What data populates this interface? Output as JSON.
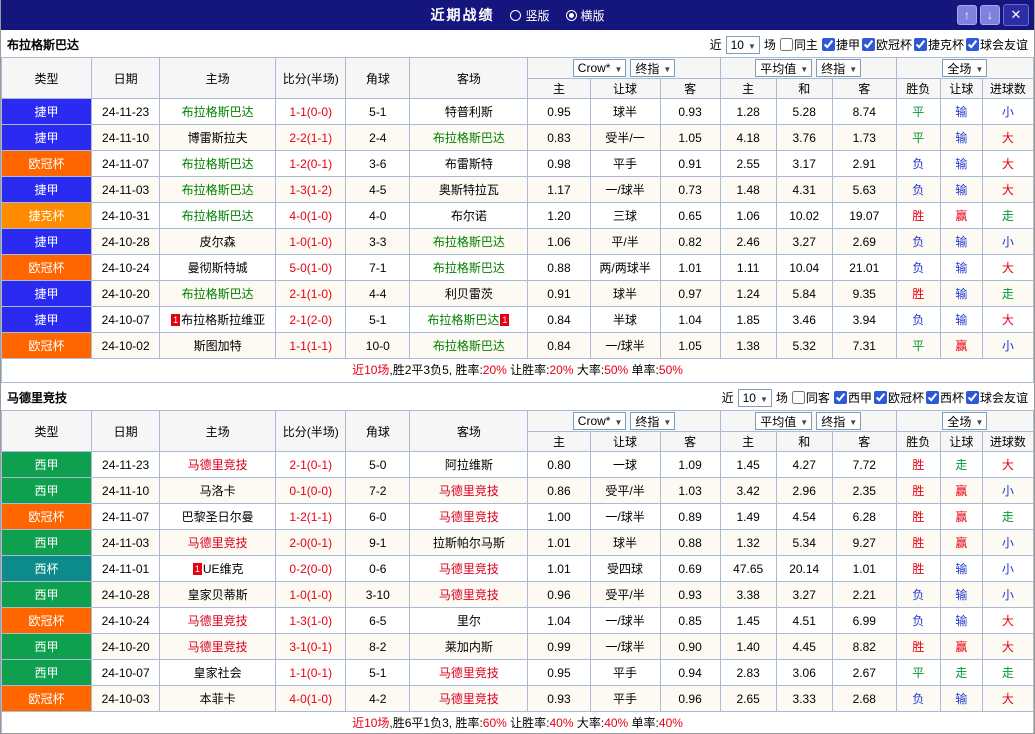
{
  "titlebar": {
    "title": "近期战绩",
    "vertical": "竖版",
    "horizontal": "横版",
    "up_icon": "↑",
    "down_icon": "↓",
    "close_icon": "✕"
  },
  "palette": {
    "win_red": "#e60012",
    "draw_green": "#009933",
    "lose_blue": "#2337cf",
    "team_green": "#008000",
    "team_red": "#d9001b"
  },
  "sections": [
    {
      "team": "布拉格斯巴达",
      "filter": {
        "near": "近",
        "count": "10",
        "games": "场",
        "same": {
          "label": "同主",
          "checked": false
        },
        "leagues": [
          {
            "label": "捷甲",
            "checked": true
          },
          {
            "label": "欧冠杯",
            "checked": true
          },
          {
            "label": "捷克杯",
            "checked": true
          },
          {
            "label": "球会友谊",
            "checked": true
          }
        ]
      },
      "header": {
        "type": "类型",
        "date": "日期",
        "home": "主场",
        "score": "比分(半场)",
        "corner": "角球",
        "away": "客场",
        "book_select": "Crow*",
        "book_index_select": "终指",
        "avg_select": "平均值",
        "avg_index_select": "终指",
        "full_select": "全场",
        "sub": [
          "主",
          "让球",
          "客",
          "主",
          "和",
          "客",
          "胜负",
          "让球",
          "进球数"
        ]
      },
      "rows": [
        {
          "league": "捷甲",
          "league_color": "#2a2af0",
          "date": "24-11-23",
          "home": "布拉格斯巴达",
          "home_color": "green",
          "home_badge": "",
          "score": "1-1(0-0)",
          "corner": "5-1",
          "away": "特普利斯",
          "away_color": "",
          "away_badge": "",
          "o1": "0.95",
          "h": "球半",
          "o2": "0.93",
          "a1": "1.28",
          "a2": "5.28",
          "a3": "8.74",
          "r1": "平",
          "r1c": "green",
          "r2": "输",
          "r2c": "blue",
          "r3": "小",
          "r3c": "blue"
        },
        {
          "league": "捷甲",
          "league_color": "#2a2af0",
          "date": "24-11-10",
          "home": "博雷斯拉夫",
          "home_color": "",
          "home_badge": "",
          "score": "2-2(1-1)",
          "corner": "2-4",
          "away": "布拉格斯巴达",
          "away_color": "green",
          "away_badge": "",
          "o1": "0.83",
          "h": "受半/一",
          "o2": "1.05",
          "a1": "4.18",
          "a2": "3.76",
          "a3": "1.73",
          "r1": "平",
          "r1c": "green",
          "r2": "输",
          "r2c": "blue",
          "r3": "大",
          "r3c": "red"
        },
        {
          "league": "欧冠杯",
          "league_color": "#ff6600",
          "date": "24-11-07",
          "home": "布拉格斯巴达",
          "home_color": "green",
          "home_badge": "",
          "score": "1-2(0-1)",
          "corner": "3-6",
          "away": "布雷斯特",
          "away_color": "",
          "away_badge": "",
          "o1": "0.98",
          "h": "平手",
          "o2": "0.91",
          "a1": "2.55",
          "a2": "3.17",
          "a3": "2.91",
          "r1": "负",
          "r1c": "blue",
          "r2": "输",
          "r2c": "blue",
          "r3": "大",
          "r3c": "red"
        },
        {
          "league": "捷甲",
          "league_color": "#2a2af0",
          "date": "24-11-03",
          "home": "布拉格斯巴达",
          "home_color": "green",
          "home_badge": "",
          "score": "1-3(1-2)",
          "corner": "4-5",
          "away": "奥斯特拉瓦",
          "away_color": "",
          "away_badge": "",
          "o1": "1.17",
          "h": "一/球半",
          "o2": "0.73",
          "a1": "1.48",
          "a2": "4.31",
          "a3": "5.63",
          "r1": "负",
          "r1c": "blue",
          "r2": "输",
          "r2c": "blue",
          "r3": "大",
          "r3c": "red"
        },
        {
          "league": "捷克杯",
          "league_color": "#ff8c00",
          "date": "24-10-31",
          "home": "布拉格斯巴达",
          "home_color": "green",
          "home_badge": "",
          "score": "4-0(1-0)",
          "corner": "4-0",
          "away": "布尔诺",
          "away_color": "",
          "away_badge": "",
          "o1": "1.20",
          "h": "三球",
          "o2": "0.65",
          "a1": "1.06",
          "a2": "10.02",
          "a3": "19.07",
          "r1": "胜",
          "r1c": "red",
          "r2": "赢",
          "r2c": "red",
          "r3": "走",
          "r3c": "green"
        },
        {
          "league": "捷甲",
          "league_color": "#2a2af0",
          "date": "24-10-28",
          "home": "皮尔森",
          "home_color": "",
          "home_badge": "",
          "score": "1-0(1-0)",
          "corner": "3-3",
          "away": "布拉格斯巴达",
          "away_color": "green",
          "away_badge": "",
          "o1": "1.06",
          "h": "平/半",
          "o2": "0.82",
          "a1": "2.46",
          "a2": "3.27",
          "a3": "2.69",
          "r1": "负",
          "r1c": "blue",
          "r2": "输",
          "r2c": "blue",
          "r3": "小",
          "r3c": "blue"
        },
        {
          "league": "欧冠杯",
          "league_color": "#ff6600",
          "date": "24-10-24",
          "home": "曼彻斯特城",
          "home_color": "",
          "home_badge": "",
          "score": "5-0(1-0)",
          "corner": "7-1",
          "away": "布拉格斯巴达",
          "away_color": "green",
          "away_badge": "",
          "o1": "0.88",
          "h": "两/两球半",
          "o2": "1.01",
          "a1": "1.11",
          "a2": "10.04",
          "a3": "21.01",
          "r1": "负",
          "r1c": "blue",
          "r2": "输",
          "r2c": "blue",
          "r3": "大",
          "r3c": "red"
        },
        {
          "league": "捷甲",
          "league_color": "#2a2af0",
          "date": "24-10-20",
          "home": "布拉格斯巴达",
          "home_color": "green",
          "home_badge": "",
          "score": "2-1(1-0)",
          "corner": "4-4",
          "away": "利贝雷茨",
          "away_color": "",
          "away_badge": "",
          "o1": "0.91",
          "h": "球半",
          "o2": "0.97",
          "a1": "1.24",
          "a2": "5.84",
          "a3": "9.35",
          "r1": "胜",
          "r1c": "red",
          "r2": "输",
          "r2c": "blue",
          "r3": "走",
          "r3c": "green"
        },
        {
          "league": "捷甲",
          "league_color": "#2a2af0",
          "date": "24-10-07",
          "home": "布拉格斯拉维亚",
          "home_color": "",
          "home_badge": "1",
          "score": "2-1(2-0)",
          "corner": "5-1",
          "away": "布拉格斯巴达",
          "away_color": "green",
          "away_badge": "1",
          "o1": "0.84",
          "h": "半球",
          "o2": "1.04",
          "a1": "1.85",
          "a2": "3.46",
          "a3": "3.94",
          "r1": "负",
          "r1c": "blue",
          "r2": "输",
          "r2c": "blue",
          "r3": "大",
          "r3c": "red"
        },
        {
          "league": "欧冠杯",
          "league_color": "#ff6600",
          "date": "24-10-02",
          "home": "斯图加特",
          "home_color": "",
          "home_badge": "",
          "score": "1-1(1-1)",
          "corner": "10-0",
          "away": "布拉格斯巴达",
          "away_color": "green",
          "away_badge": "",
          "o1": "0.84",
          "h": "一/球半",
          "o2": "1.05",
          "a1": "1.38",
          "a2": "5.32",
          "a3": "7.31",
          "r1": "平",
          "r1c": "green",
          "r2": "赢",
          "r2c": "red",
          "r3": "小",
          "r3c": "blue"
        }
      ],
      "summary": [
        {
          "t": "近10场",
          "c": "red"
        },
        {
          "t": ",胜2平3负5, 胜率:",
          "c": "black"
        },
        {
          "t": "20%",
          "c": "red"
        },
        {
          "t": " 让胜率:",
          "c": "black"
        },
        {
          "t": "20%",
          "c": "red"
        },
        {
          "t": " 大率:",
          "c": "black"
        },
        {
          "t": "50%",
          "c": "red"
        },
        {
          "t": " 单率:",
          "c": "black"
        },
        {
          "t": "50%",
          "c": "red"
        }
      ]
    },
    {
      "team": "马德里竞技",
      "filter": {
        "near": "近",
        "count": "10",
        "games": "场",
        "same": {
          "label": "同客",
          "checked": false
        },
        "leagues": [
          {
            "label": "西甲",
            "checked": true
          },
          {
            "label": "欧冠杯",
            "checked": true
          },
          {
            "label": "西杯",
            "checked": true
          },
          {
            "label": "球会友谊",
            "checked": true
          }
        ]
      },
      "header": {
        "type": "类型",
        "date": "日期",
        "home": "主场",
        "score": "比分(半场)",
        "corner": "角球",
        "away": "客场",
        "book_select": "Crow*",
        "book_index_select": "终指",
        "avg_select": "平均值",
        "avg_index_select": "终指",
        "full_select": "全场",
        "sub": [
          "主",
          "让球",
          "客",
          "主",
          "和",
          "客",
          "胜负",
          "让球",
          "进球数"
        ]
      },
      "rows": [
        {
          "league": "西甲",
          "league_color": "#0ea04e",
          "date": "24-11-23",
          "home": "马德里竞技",
          "home_color": "red",
          "home_badge": "",
          "score": "2-1(0-1)",
          "corner": "5-0",
          "away": "阿拉维斯",
          "away_color": "",
          "away_badge": "",
          "o1": "0.80",
          "h": "一球",
          "o2": "1.09",
          "a1": "1.45",
          "a2": "4.27",
          "a3": "7.72",
          "r1": "胜",
          "r1c": "red",
          "r2": "走",
          "r2c": "green",
          "r3": "大",
          "r3c": "red"
        },
        {
          "league": "西甲",
          "league_color": "#0ea04e",
          "date": "24-11-10",
          "home": "马洛卡",
          "home_color": "",
          "home_badge": "",
          "score": "0-1(0-0)",
          "corner": "7-2",
          "away": "马德里竞技",
          "away_color": "red",
          "away_badge": "",
          "o1": "0.86",
          "h": "受平/半",
          "o2": "1.03",
          "a1": "3.42",
          "a2": "2.96",
          "a3": "2.35",
          "r1": "胜",
          "r1c": "red",
          "r2": "赢",
          "r2c": "red",
          "r3": "小",
          "r3c": "blue"
        },
        {
          "league": "欧冠杯",
          "league_color": "#ff6600",
          "date": "24-11-07",
          "home": "巴黎圣日尔曼",
          "home_color": "",
          "home_badge": "",
          "score": "1-2(1-1)",
          "corner": "6-0",
          "away": "马德里竞技",
          "away_color": "red",
          "away_badge": "",
          "o1": "1.00",
          "h": "一/球半",
          "o2": "0.89",
          "a1": "1.49",
          "a2": "4.54",
          "a3": "6.28",
          "r1": "胜",
          "r1c": "red",
          "r2": "赢",
          "r2c": "red",
          "r3": "走",
          "r3c": "green"
        },
        {
          "league": "西甲",
          "league_color": "#0ea04e",
          "date": "24-11-03",
          "home": "马德里竞技",
          "home_color": "red",
          "home_badge": "",
          "score": "2-0(0-1)",
          "corner": "9-1",
          "away": "拉斯帕尔马斯",
          "away_color": "",
          "away_badge": "",
          "o1": "1.01",
          "h": "球半",
          "o2": "0.88",
          "a1": "1.32",
          "a2": "5.34",
          "a3": "9.27",
          "r1": "胜",
          "r1c": "red",
          "r2": "赢",
          "r2c": "red",
          "r3": "小",
          "r3c": "blue"
        },
        {
          "league": "西杯",
          "league_color": "#0d8b8b",
          "date": "24-11-01",
          "home": "UE维克",
          "home_color": "",
          "home_badge": "1",
          "score": "0-2(0-0)",
          "corner": "0-6",
          "away": "马德里竞技",
          "away_color": "red",
          "away_badge": "",
          "o1": "1.01",
          "h": "受四球",
          "o2": "0.69",
          "a1": "47.65",
          "a2": "20.14",
          "a3": "1.01",
          "r1": "胜",
          "r1c": "red",
          "r2": "输",
          "r2c": "blue",
          "r3": "小",
          "r3c": "blue"
        },
        {
          "league": "西甲",
          "league_color": "#0ea04e",
          "date": "24-10-28",
          "home": "皇家贝蒂斯",
          "home_color": "",
          "home_badge": "",
          "score": "1-0(1-0)",
          "corner": "3-10",
          "away": "马德里竞技",
          "away_color": "red",
          "away_badge": "",
          "o1": "0.96",
          "h": "受平/半",
          "o2": "0.93",
          "a1": "3.38",
          "a2": "3.27",
          "a3": "2.21",
          "r1": "负",
          "r1c": "blue",
          "r2": "输",
          "r2c": "blue",
          "r3": "小",
          "r3c": "blue"
        },
        {
          "league": "欧冠杯",
          "league_color": "#ff6600",
          "date": "24-10-24",
          "home": "马德里竞技",
          "home_color": "red",
          "home_badge": "",
          "score": "1-3(1-0)",
          "corner": "6-5",
          "away": "里尔",
          "away_color": "",
          "away_badge": "",
          "o1": "1.04",
          "h": "一/球半",
          "o2": "0.85",
          "a1": "1.45",
          "a2": "4.51",
          "a3": "6.99",
          "r1": "负",
          "r1c": "blue",
          "r2": "输",
          "r2c": "blue",
          "r3": "大",
          "r3c": "red"
        },
        {
          "league": "西甲",
          "league_color": "#0ea04e",
          "date": "24-10-20",
          "home": "马德里竞技",
          "home_color": "red",
          "home_badge": "",
          "score": "3-1(0-1)",
          "corner": "8-2",
          "away": "莱加内斯",
          "away_color": "",
          "away_badge": "",
          "o1": "0.99",
          "h": "一/球半",
          "o2": "0.90",
          "a1": "1.40",
          "a2": "4.45",
          "a3": "8.82",
          "r1": "胜",
          "r1c": "red",
          "r2": "赢",
          "r2c": "red",
          "r3": "大",
          "r3c": "red"
        },
        {
          "league": "西甲",
          "league_color": "#0ea04e",
          "date": "24-10-07",
          "home": "皇家社会",
          "home_color": "",
          "home_badge": "",
          "score": "1-1(0-1)",
          "corner": "5-1",
          "away": "马德里竞技",
          "away_color": "red",
          "away_badge": "",
          "o1": "0.95",
          "h": "平手",
          "o2": "0.94",
          "a1": "2.83",
          "a2": "3.06",
          "a3": "2.67",
          "r1": "平",
          "r1c": "green",
          "r2": "走",
          "r2c": "green",
          "r3": "走",
          "r3c": "green"
        },
        {
          "league": "欧冠杯",
          "league_color": "#ff6600",
          "date": "24-10-03",
          "home": "本菲卡",
          "home_color": "",
          "home_badge": "",
          "score": "4-0(1-0)",
          "corner": "4-2",
          "away": "马德里竞技",
          "away_color": "red",
          "away_badge": "",
          "o1": "0.93",
          "h": "平手",
          "o2": "0.96",
          "a1": "2.65",
          "a2": "3.33",
          "a3": "2.68",
          "r1": "负",
          "r1c": "blue",
          "r2": "输",
          "r2c": "blue",
          "r3": "大",
          "r3c": "red"
        }
      ],
      "summary": [
        {
          "t": "近10场",
          "c": "red"
        },
        {
          "t": ",胜6平1负3, 胜率:",
          "c": "black"
        },
        {
          "t": "60%",
          "c": "red"
        },
        {
          "t": " 让胜率:",
          "c": "black"
        },
        {
          "t": "40%",
          "c": "red"
        },
        {
          "t": " 大率:",
          "c": "black"
        },
        {
          "t": "40%",
          "c": "red"
        },
        {
          "t": " 单率:",
          "c": "black"
        },
        {
          "t": "40%",
          "c": "red"
        }
      ]
    }
  ]
}
